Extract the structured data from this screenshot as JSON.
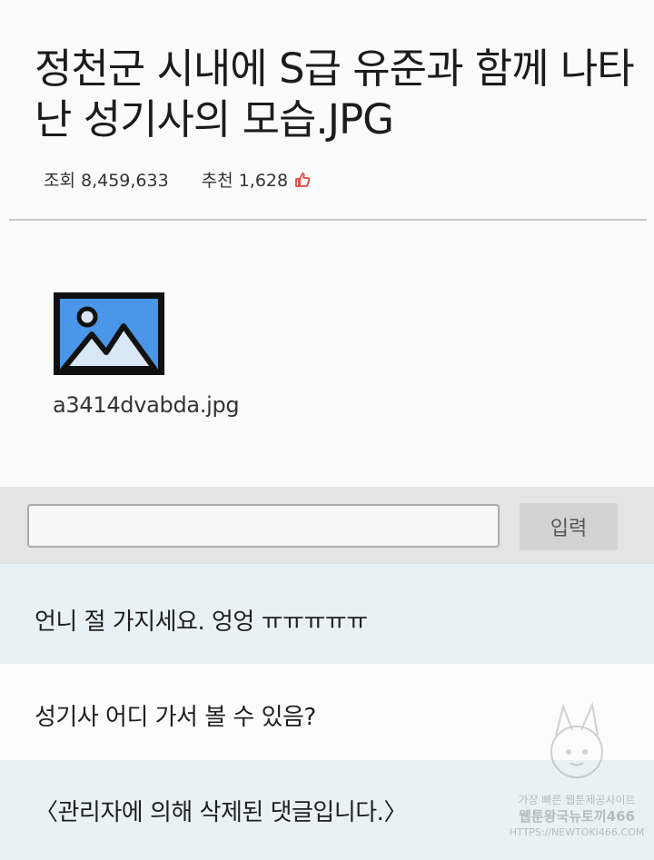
{
  "post": {
    "title": "정천군 시내에 S급 유준과 함께 나타난 성기사의 모습.JPG",
    "views": "조회 8,459,633",
    "likes": "추천 1,628",
    "like_icon": "thumbs-up-icon",
    "like_icon_color": "#e0463c"
  },
  "attachment": {
    "icon": "image-icon",
    "filename": "a3414dvabda.jpg",
    "icon_color": "#4a96e8"
  },
  "comment_form": {
    "input_value": "",
    "submit_label": "입력"
  },
  "comments": [
    {
      "text": "언니 절 가지세요. 엉엉 ㅠㅠㅠㅠㅠ"
    },
    {
      "text": "성기사 어디 가서 볼 수 있음?"
    },
    {
      "text": "〈관리자에 의해 삭제된 댓글입니다.〉"
    }
  ],
  "watermark": {
    "line1": "가장 빠른 웹툰제공사이트",
    "line2": "웹툰왕국뉴토끼466",
    "line3": "HTTPS://NEWTOKI466.COM"
  }
}
